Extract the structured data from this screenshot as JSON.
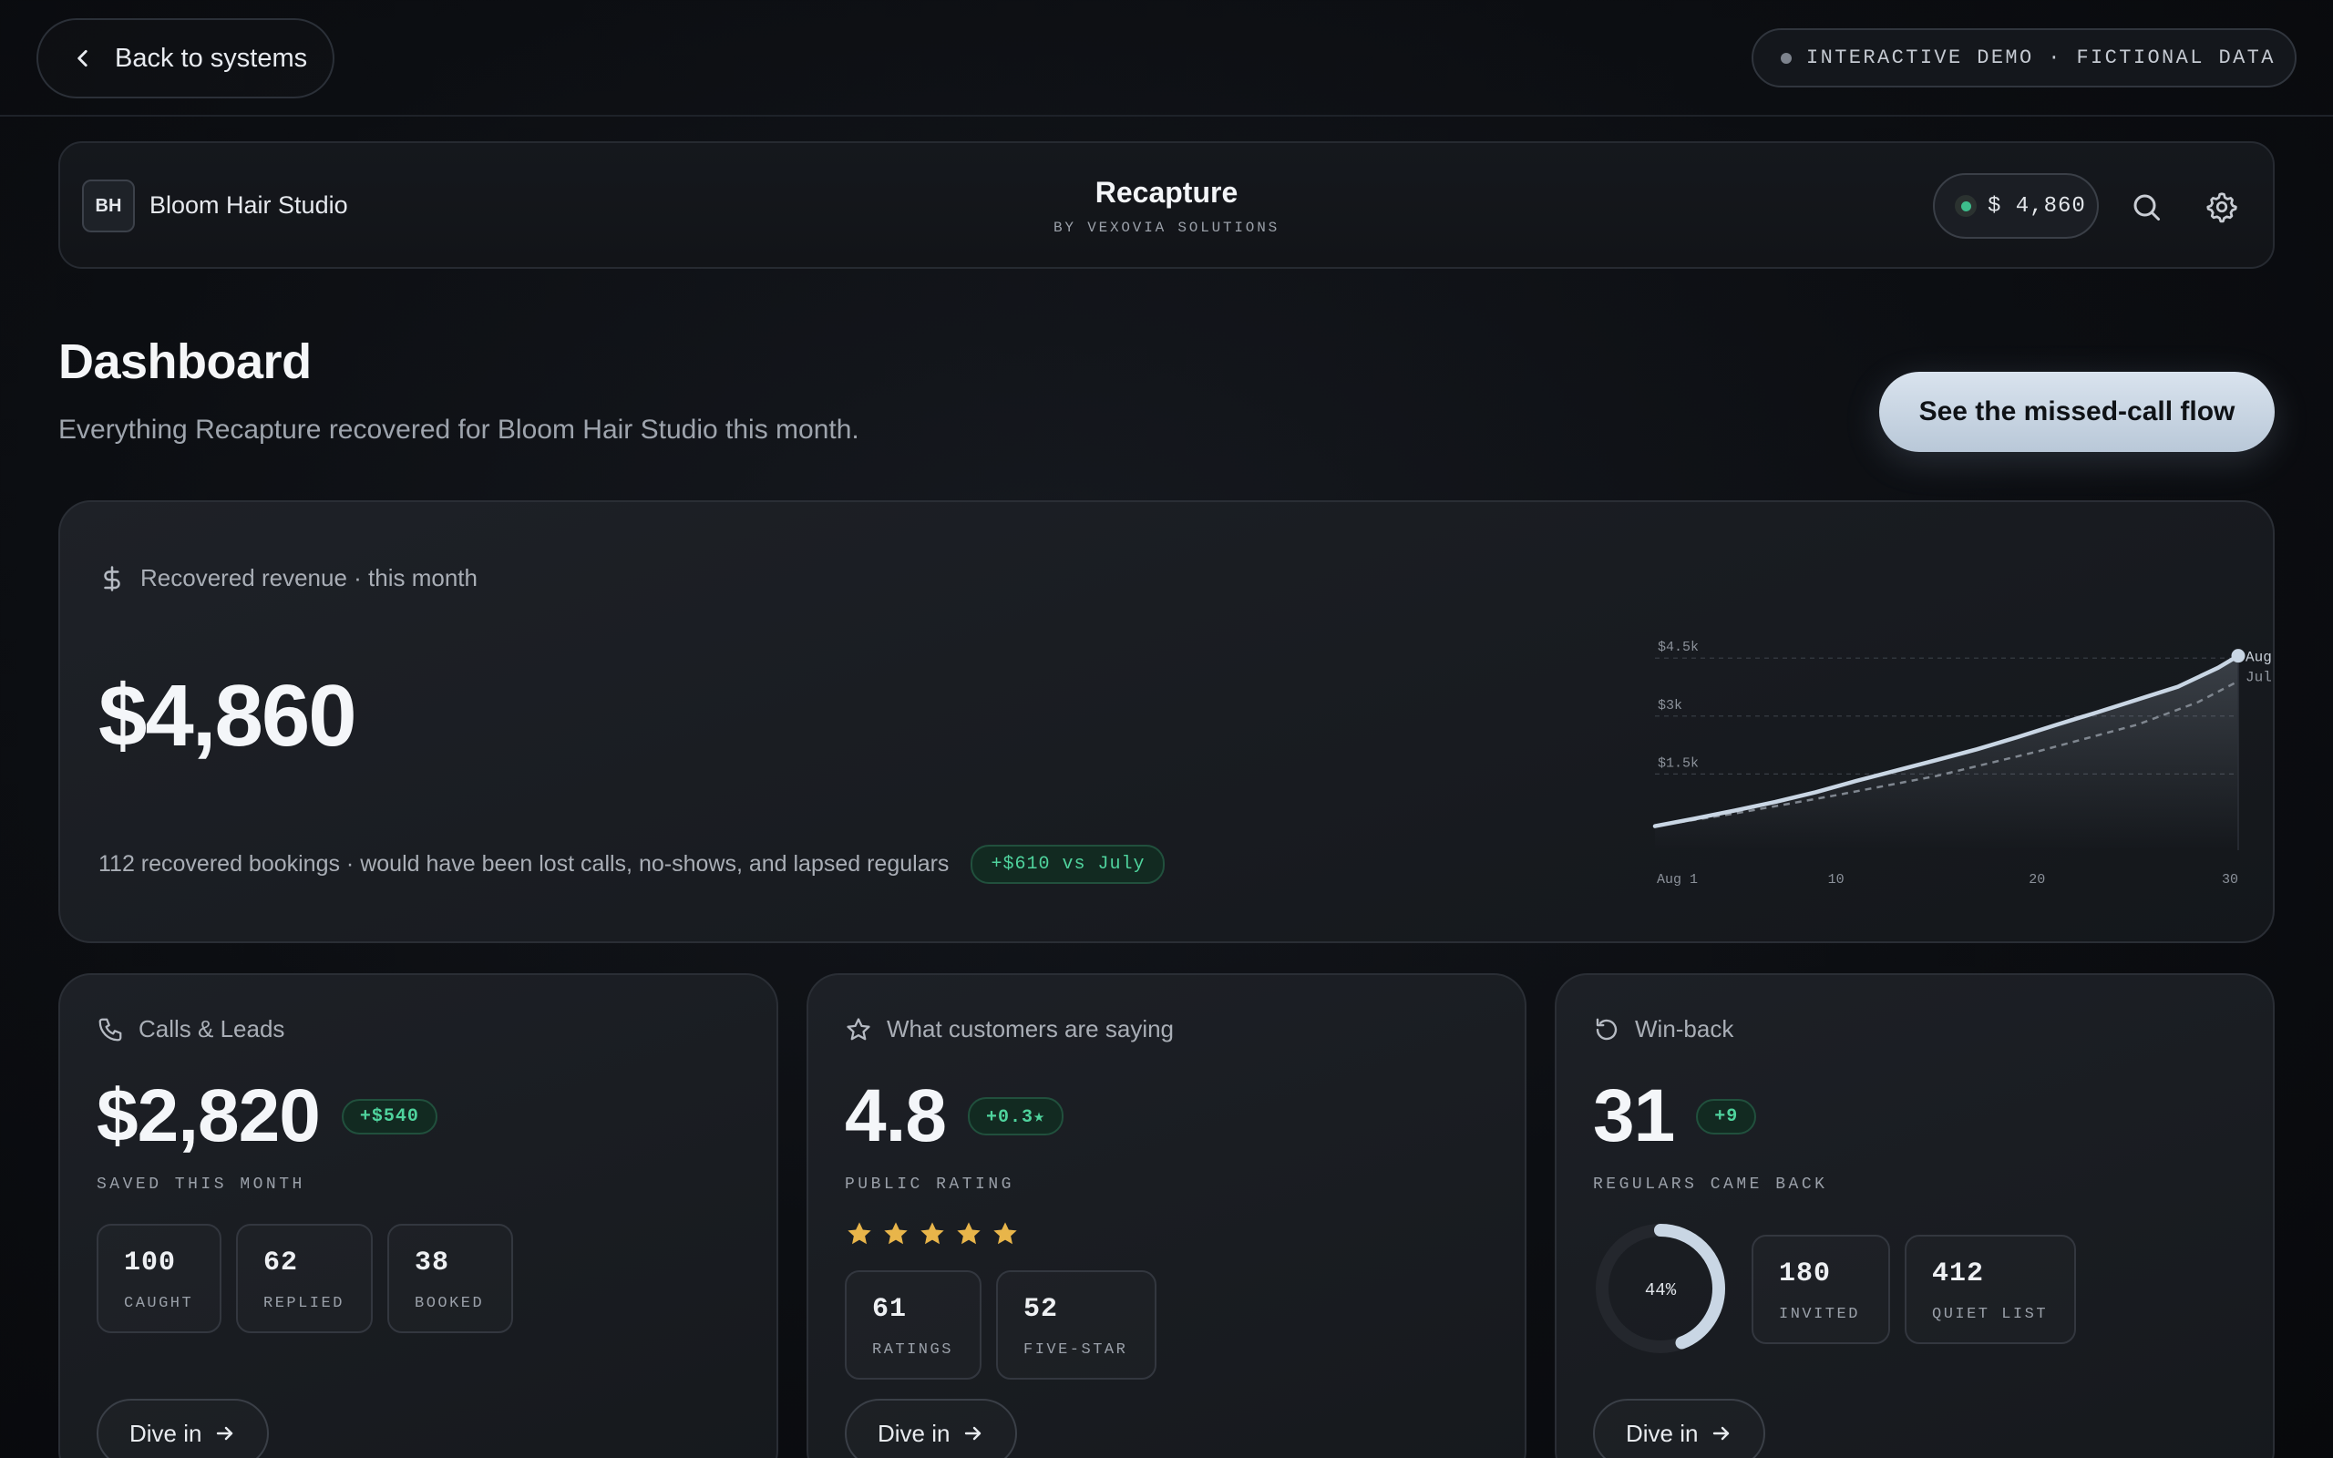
{
  "topbar": {
    "back_label": "Back to systems",
    "demo_label": "INTERACTIVE DEMO · FICTIONAL DATA"
  },
  "appbar": {
    "logo_initials": "BH",
    "studio_name": "Bloom Hair Studio",
    "app_title": "Recapture",
    "app_subtitle": "BY VEXOVIA SOLUTIONS",
    "balance": "$ 4,860",
    "icons": [
      "search-icon",
      "gear-icon"
    ]
  },
  "page": {
    "title": "Dashboard",
    "subtitle": "Everything Recapture recovered for Bloom Hair Studio this month.",
    "cta_label": "See the missed-call flow"
  },
  "hero": {
    "label": "Recovered revenue · this month",
    "value": "$4,860",
    "footnote": "112 recovered bookings · would have been lost calls, no-shows, and lapsed regulars",
    "badge": "+$610 vs July"
  },
  "calls": {
    "label": "Calls & Leads",
    "value": "$2,820",
    "badge": "+$540",
    "caption": "SAVED THIS MONTH",
    "stats": [
      {
        "num": "100",
        "lbl": "CAUGHT"
      },
      {
        "num": "62",
        "lbl": "REPLIED"
      },
      {
        "num": "38",
        "lbl": "BOOKED"
      }
    ],
    "dive_label": "Dive in"
  },
  "reviews": {
    "label": "What customers are saying",
    "value": "4.8",
    "badge": "+0.3★",
    "caption": "PUBLIC RATING",
    "stars": 5,
    "star_color": "#e8b54a",
    "stats": [
      {
        "num": "61",
        "lbl": "RATINGS"
      },
      {
        "num": "52",
        "lbl": "FIVE-STAR"
      }
    ],
    "dive_label": "Dive in"
  },
  "winback": {
    "label": "Win-back",
    "value": "31",
    "badge": "+9",
    "caption": "REGULARS CAME BACK",
    "ring_label": "44%",
    "ring_fraction": 0.44,
    "stats": [
      {
        "num": "180",
        "lbl": "INVITED"
      },
      {
        "num": "412",
        "lbl": "QUIET LIST"
      }
    ],
    "dive_label": "Dive in"
  },
  "colors": {
    "accent": "#c9d6e4",
    "positive": "#4fd39d",
    "live": "#3dbd8c"
  },
  "chart_data": {
    "type": "line",
    "x_ticks": [
      "Aug 1",
      "10",
      "20",
      "30"
    ],
    "x_tick_values": [
      1,
      10,
      20,
      30
    ],
    "y_ticks": [
      "$1.5k",
      "$3k",
      "$4.5k"
    ],
    "y_tick_values": [
      1500,
      3000,
      4500
    ],
    "ylim": [
      0,
      5000
    ],
    "xlim": [
      1,
      30
    ],
    "grid": true,
    "series": [
      {
        "name": "Aug",
        "style": "solid",
        "color": "#c9d6e4",
        "x": [
          1,
          3,
          5,
          7,
          9,
          11,
          13,
          15,
          17,
          19,
          21,
          23,
          25,
          27,
          29,
          30
        ],
        "values": [
          150,
          350,
          560,
          780,
          1030,
          1320,
          1590,
          1860,
          2140,
          2450,
          2780,
          3100,
          3430,
          3760,
          4250,
          4560
        ]
      },
      {
        "name": "Jul",
        "style": "dashed",
        "color": "#7f868f",
        "x": [
          1,
          5,
          10,
          15,
          20,
          25,
          28,
          30
        ],
        "values": [
          150,
          480,
          950,
          1450,
          2080,
          2780,
          3360,
          3900
        ]
      }
    ]
  }
}
